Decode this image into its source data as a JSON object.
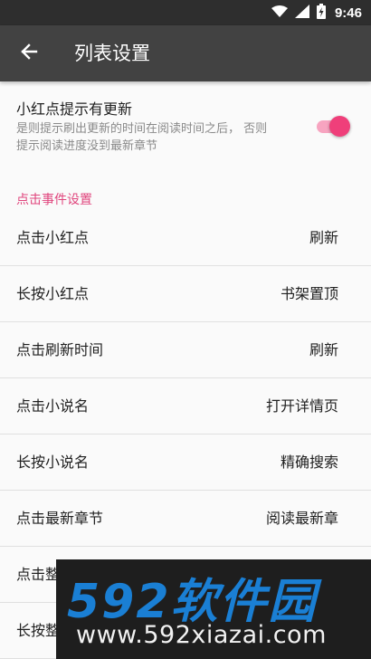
{
  "status_bar": {
    "time": "9:46",
    "icons": [
      "wifi-icon",
      "signal-icon",
      "battery-icon"
    ]
  },
  "app_bar": {
    "back_icon": "arrow-left-icon",
    "title": "列表设置"
  },
  "red_dot_setting": {
    "title": "小红点提示有更新",
    "description": "是则提示刷出更新的时间在阅读时间之后， 否则提示阅读进度没到最新章节",
    "enabled": true
  },
  "section_header": "点击事件设置",
  "event_settings": [
    {
      "label": "点击小红点",
      "value": "刷新"
    },
    {
      "label": "长按小红点",
      "value": "书架置顶"
    },
    {
      "label": "点击刷新时间",
      "value": "刷新"
    },
    {
      "label": "点击小说名",
      "value": "打开详情页"
    },
    {
      "label": "长按小说名",
      "value": "精确搜索"
    },
    {
      "label": "点击最新章节",
      "value": "阅读最新章"
    },
    {
      "label": "点击整",
      "value": ""
    },
    {
      "label": "长按整",
      "value": ""
    }
  ],
  "watermark": {
    "logo": "592软件园",
    "url": "www.592xiazai.com"
  },
  "colors": {
    "status_bar": "#2e2e2e",
    "app_bar": "#424242",
    "accent": "#ef3f7a",
    "section_header": "#e0457d",
    "watermark_logo": "#1a7fd4"
  }
}
